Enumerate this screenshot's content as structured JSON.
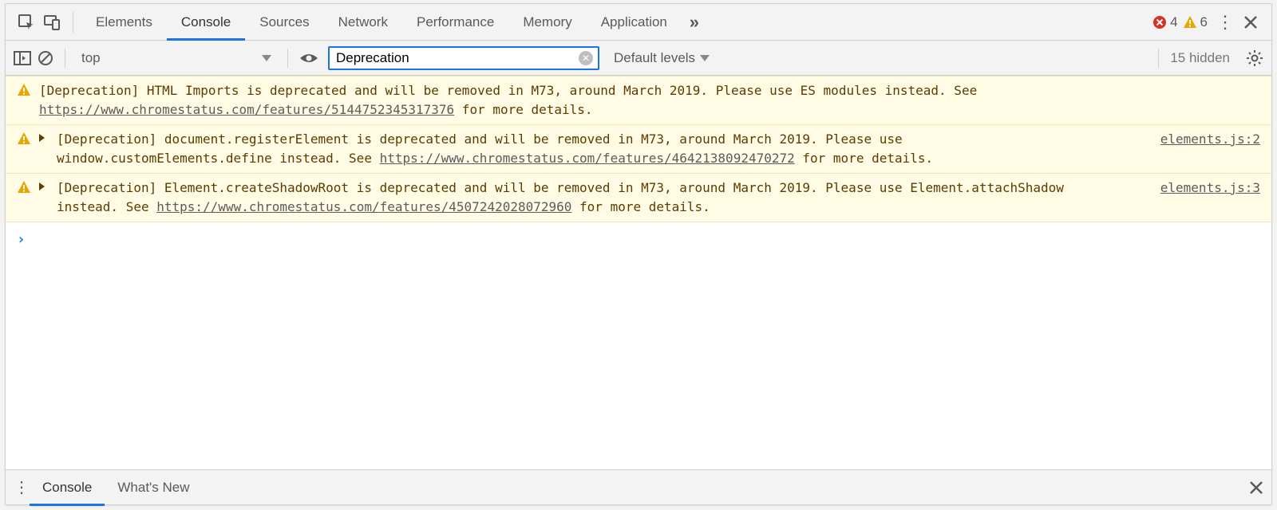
{
  "tabs": {
    "elements": "Elements",
    "console": "Console",
    "sources": "Sources",
    "network": "Network",
    "performance": "Performance",
    "memory": "Memory",
    "application": "Application"
  },
  "status": {
    "error_count": "4",
    "warning_count": "6"
  },
  "toolbar": {
    "context": "top",
    "filter_value": "Deprecation",
    "levels_label": "Default levels",
    "hidden_label": "15 hidden"
  },
  "messages": [
    {
      "expandable": false,
      "text_pre": "[Deprecation] HTML Imports is deprecated and will be removed in M73, around March 2019. Please use ES modules instead. See ",
      "link": "https://www.chromestatus.com/features/5144752345317376",
      "text_post": " for more details.",
      "src": ""
    },
    {
      "expandable": true,
      "text_pre": "[Deprecation] document.registerElement is deprecated and will be removed in M73, around March 2019. Please use window.customElements.define instead. See ",
      "link": "https://www.chromestatus.com/features/4642138092470272",
      "text_post": " for more details.",
      "src": "elements.js:2"
    },
    {
      "expandable": true,
      "text_pre": "[Deprecation] Element.createShadowRoot is deprecated and will be removed in M73, around March 2019. Please use Element.attachShadow instead. See ",
      "link": "https://www.chromestatus.com/features/4507242028072960",
      "text_post": " for more details.",
      "src": "elements.js:3"
    }
  ],
  "prompt_glyph": "›",
  "drawer": {
    "console": "Console",
    "whats_new": "What's New"
  }
}
